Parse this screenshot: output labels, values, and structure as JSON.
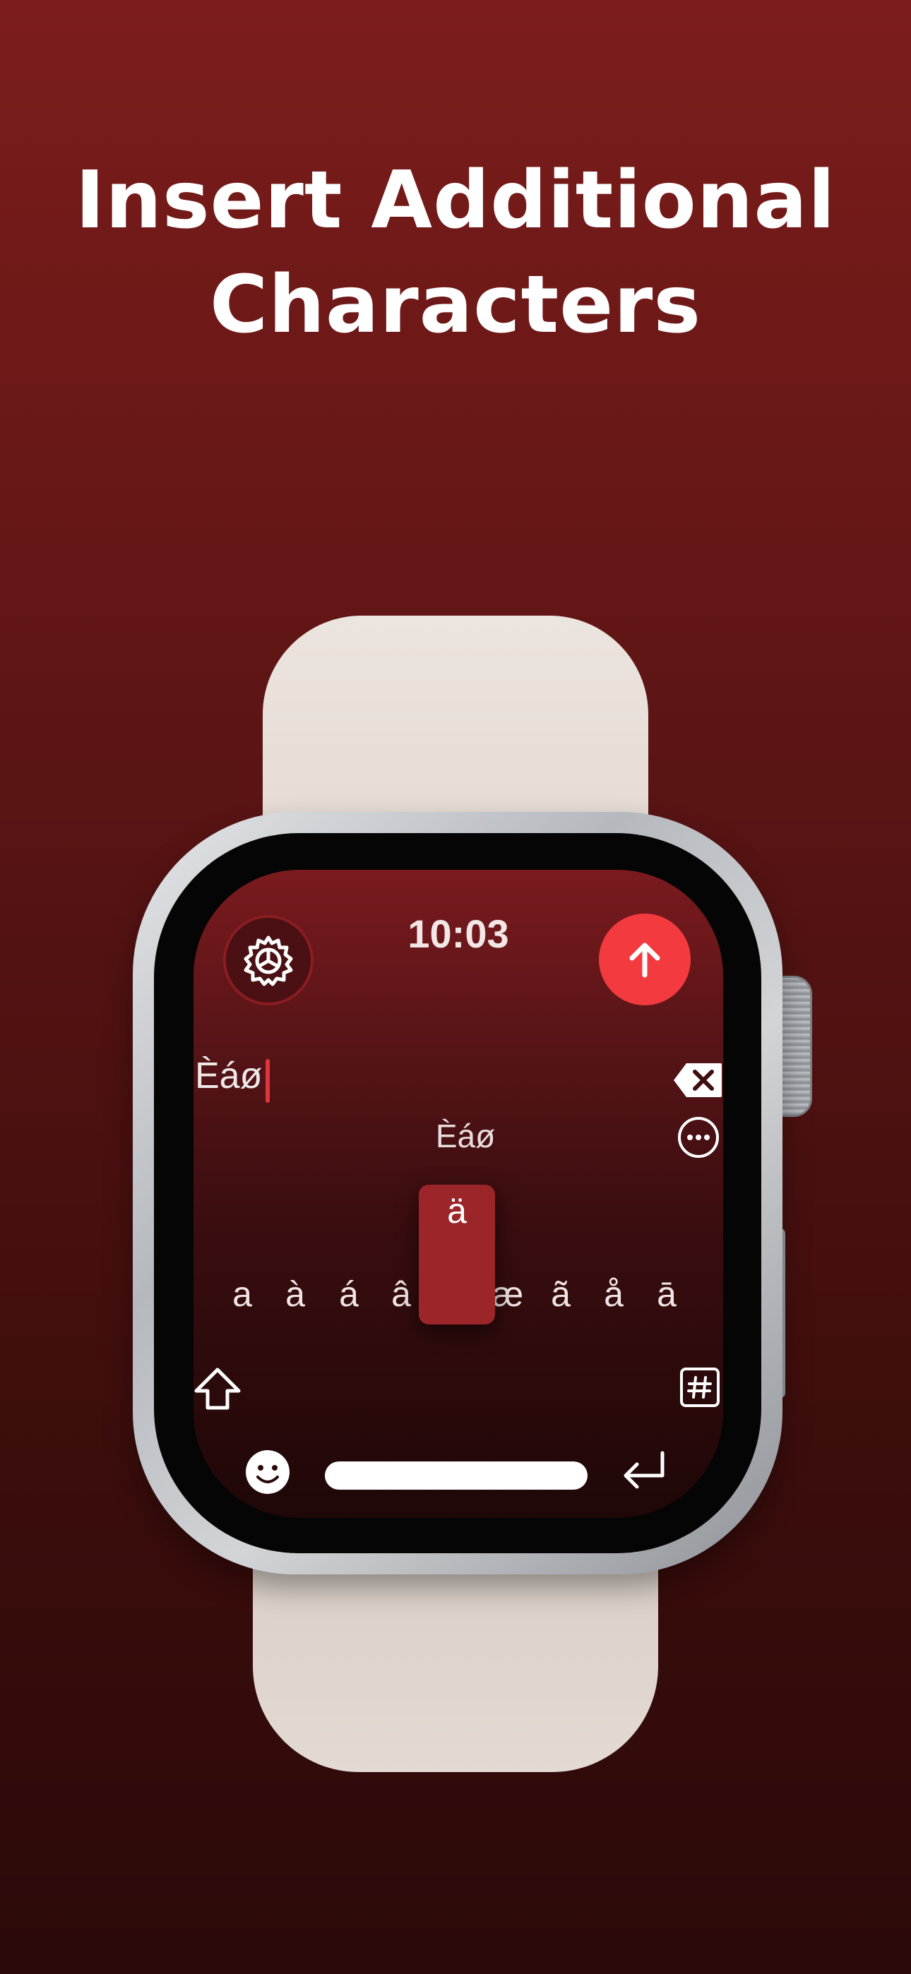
{
  "headline": {
    "line1": "Insert Additional",
    "line2": "Characters"
  },
  "watch": {
    "time": "10:03",
    "input_text": "Èáø",
    "suggestion": "Èáø",
    "popup_char": "ä",
    "char_row": [
      "a",
      "à",
      "á",
      "â",
      "ä",
      "æ",
      "ã",
      "å",
      "ā"
    ],
    "icons": {
      "settings": "gear-icon",
      "send": "arrow-up-icon",
      "backspace": "backspace-icon",
      "more": "ellipsis-circle-icon",
      "shift": "shift-arrow-icon",
      "symbols": "hash-icon",
      "emoji": "smiley-icon",
      "return": "return-arrow-icon"
    },
    "colors": {
      "accent": "#f23a3f",
      "popup": "#9b2528"
    }
  }
}
